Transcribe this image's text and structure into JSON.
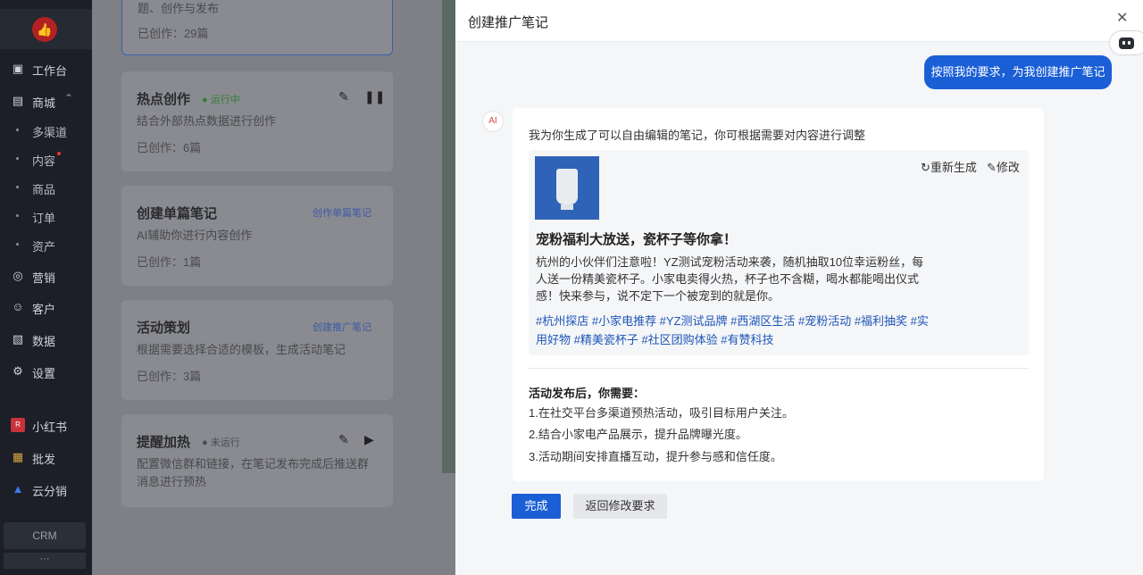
{
  "sidebar": {
    "logo_icon": "thumbs-up-icon",
    "items": [
      {
        "label": "工作台",
        "icon": "workbench-icon"
      },
      {
        "label": "商城",
        "icon": "store-icon"
      },
      {
        "label": "营销",
        "icon": "marketing-icon"
      },
      {
        "label": "客户",
        "icon": "customer-icon"
      },
      {
        "label": "数据",
        "icon": "data-icon"
      },
      {
        "label": "设置",
        "icon": "settings-icon"
      },
      {
        "label": "小红书",
        "icon": "xiaohongshu-icon"
      },
      {
        "label": "批发",
        "icon": "wholesale-icon"
      },
      {
        "label": "云分销",
        "icon": "cloud-distribution-icon"
      }
    ],
    "sub_items": [
      "多渠道",
      "内容",
      "商品",
      "订单",
      "资产"
    ],
    "crm_label": "CRM",
    "more_label": "···"
  },
  "main": {
    "top_card": {
      "desc": "题、创作与发布",
      "count": "已创作：29篇"
    },
    "cards": [
      {
        "title": "热点创作",
        "status": "运行中",
        "desc": "结合外部热点数据进行创作",
        "count": "已创作：6篇"
      },
      {
        "title": "创建单篇笔记",
        "tag": "创作单篇笔记",
        "desc": "AI辅助你进行内容创作",
        "count": "已创作：1篇"
      },
      {
        "title": "活动策划",
        "tag": "创建推广笔记",
        "desc": "根据需要选择合适的模板，生成活动笔记",
        "count": "已创作：3篇"
      },
      {
        "title": "提醒加热",
        "status": "未运行",
        "desc": "配置微信群和链接，在笔记发布完成后推送群消息进行预热"
      }
    ]
  },
  "panel": {
    "title": "创建推广笔记",
    "user_message": "按照我的要求，为我创建推广笔记",
    "ai_intro": "我为你生成了可以自由编辑的笔记，你可根据需要对内容进行调整",
    "note": {
      "regenerate_label": "重新生成",
      "edit_label": "修改",
      "title": "宠粉福利大放送，瓷杯子等你拿！",
      "body": "杭州的小伙伴们注意啦！YZ测试宠粉活动来袭，随机抽取10位幸运粉丝，每人送一份精美瓷杯子。小家电卖得火热，杯子也不含糊，喝水都能喝出仪式感！快来参与，说不定下一个被宠到的就是你。",
      "tags": "#杭州探店 #小家电推荐 #YZ测试品牌 #西湖区生活 #宠粉活动 #福利抽奖 #实用好物 #精美瓷杯子 #社区团购体验 #有赞科技"
    },
    "after_title": "活动发布后，你需要：",
    "after_items": [
      "1.在社交平台多渠道预热活动，吸引目标用户关注。",
      "2.结合小家电产品展示，提升品牌曝光度。",
      "3.活动期间安排直播互动，提升参与感和信任度。"
    ],
    "done_label": "完成",
    "back_label": "返回修改要求"
  }
}
